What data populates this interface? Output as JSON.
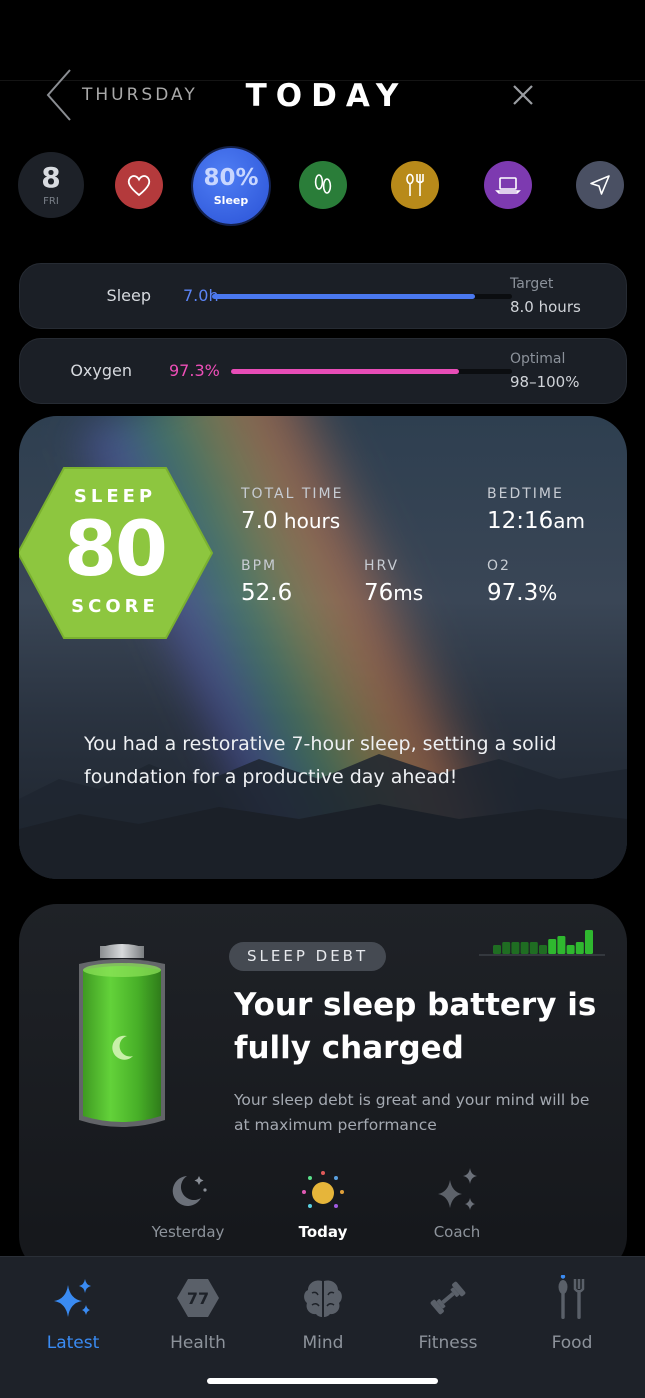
{
  "header": {
    "back_label": "THURSDAY",
    "title": "TODAY"
  },
  "day_row": {
    "date_number": "8",
    "date_dow": "FRI",
    "sleep_percent": "80%",
    "sleep_label": "Sleep",
    "icons": [
      "heart-icon",
      "footprints-icon",
      "fork-spoon-icon",
      "laptop-icon",
      "navigation-arrow-icon"
    ],
    "colors": {
      "heart": "#b43a3c",
      "feet": "#2a7d39",
      "food": "#b88a1a",
      "screen": "#7d3ab0",
      "nav": "#4a5063",
      "sleep": "#2f5ee0"
    }
  },
  "metrics": [
    {
      "label": "Sleep",
      "value": "7.0h",
      "progress": 0.875,
      "target_label": "Target",
      "target_value": "8.0 hours",
      "color": "#4a78f0"
    },
    {
      "label": "Oxygen",
      "value": "97.3%",
      "progress": 0.81,
      "target_label": "Optimal",
      "target_value": "98–100%",
      "color": "#e84db7"
    }
  ],
  "score_card": {
    "hex_top": "SLEEP",
    "score": "80",
    "hex_bottom": "SCORE",
    "hex_color": "#8dc63f",
    "stats": {
      "total_time": {
        "label": "TOTAL TIME",
        "value": "7.0",
        "unit": " hours"
      },
      "bedtime": {
        "label": "BEDTIME",
        "value": "12:16",
        "unit": "am"
      },
      "bpm": {
        "label": "BPM",
        "value": "52.6",
        "unit": ""
      },
      "hrv": {
        "label": "HRV",
        "value": "76",
        "unit": "ms"
      },
      "o2": {
        "label": "O2",
        "value": "97.3",
        "unit": "%"
      }
    },
    "summary": "You had a restorative 7-hour sleep, setting a solid foundation for a productive day ahead!"
  },
  "debt_card": {
    "badge": "SLEEP DEBT",
    "title": "Your sleep battery is fully charged",
    "description": "Your sleep debt is great and your mind will be at maximum performance",
    "battery_level": 1.0,
    "mini_chart_values": [
      3,
      4,
      4,
      4,
      4,
      3,
      5,
      6,
      3,
      4,
      8
    ],
    "accent": "#2fb82f"
  },
  "selector": {
    "items": [
      {
        "label": "Yesterday",
        "icon": "moon-stars-icon"
      },
      {
        "label": "Today",
        "icon": "sun-icon"
      },
      {
        "label": "Coach",
        "icon": "sparkles-icon"
      }
    ],
    "selected": "Today"
  },
  "tabbar": {
    "tabs": [
      {
        "label": "Latest",
        "icon": "sparkles-icon"
      },
      {
        "label": "Health",
        "icon": "hexagon-badge-icon",
        "badge": "77"
      },
      {
        "label": "Mind",
        "icon": "brain-icon"
      },
      {
        "label": "Fitness",
        "icon": "dumbbell-icon"
      },
      {
        "label": "Food",
        "icon": "fork-spoon-icon"
      }
    ],
    "active": "Latest",
    "active_color": "#3a8bf2"
  }
}
